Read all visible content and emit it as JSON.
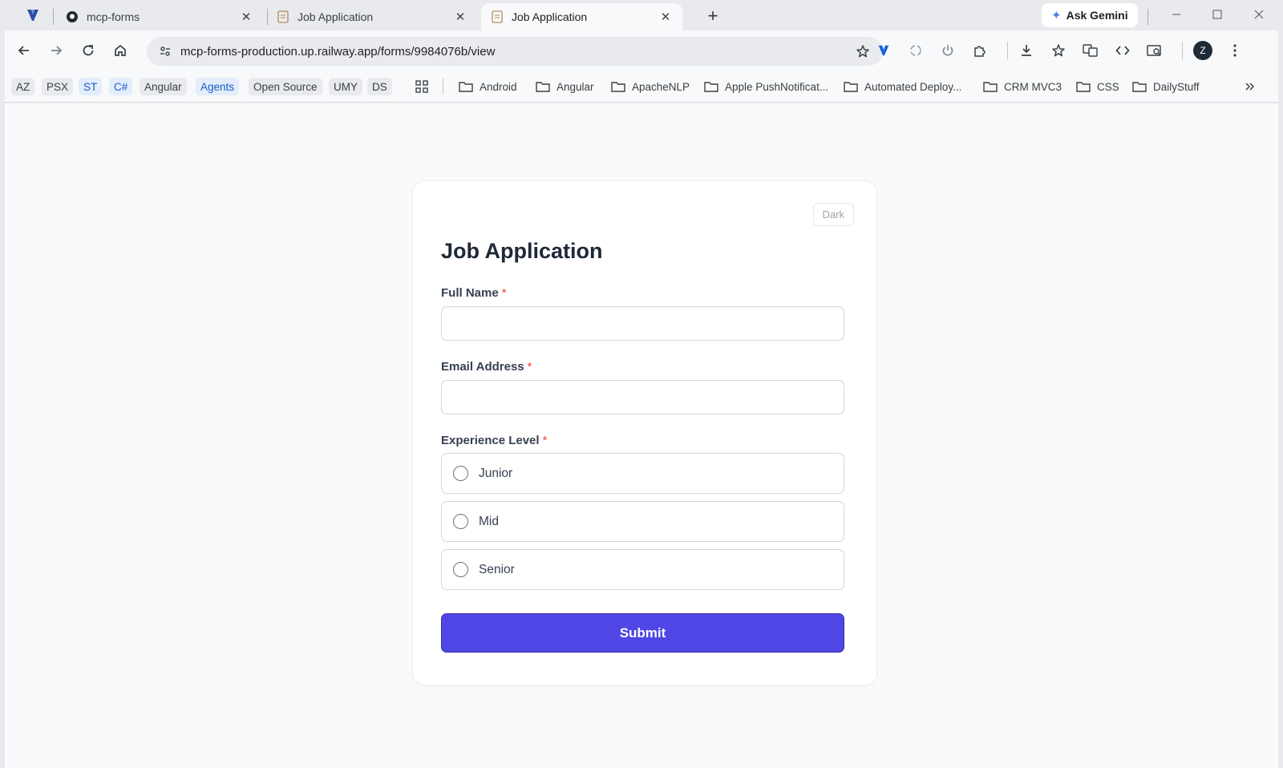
{
  "browser": {
    "tabs": [
      {
        "title": "mcp-forms",
        "active": false
      },
      {
        "title": "Job Application",
        "active": false
      },
      {
        "title": "Job Application",
        "active": true
      }
    ],
    "ask_gemini": "Ask Gemini",
    "url": "mcp-forms-production.up.railway.app/forms/9984076b/view",
    "profile_initial": "Z",
    "bookmarks": {
      "chips": [
        "AZ",
        "PSX",
        "ST",
        "C#",
        "Angular",
        "Agents",
        "Open Source",
        "UMY",
        "DS"
      ],
      "folders": [
        "Android",
        "Angular",
        "ApacheNLP",
        "Apple PushNotificat...",
        "Automated Deploy...",
        "CRM MVC3",
        "CSS",
        "DailyStuff"
      ]
    }
  },
  "form": {
    "theme_toggle": "Dark",
    "title": "Job Application",
    "fields": {
      "full_name": {
        "label": "Full Name",
        "required_mark": "*",
        "value": ""
      },
      "email": {
        "label": "Email Address",
        "required_mark": "*",
        "value": ""
      },
      "experience": {
        "label": "Experience Level",
        "required_mark": "*",
        "options": [
          "Junior",
          "Mid",
          "Senior"
        ],
        "selected": null
      }
    },
    "submit_label": "Submit"
  },
  "colors": {
    "primary": "#4f46e5",
    "required": "#ef4444",
    "page_bg": "#f9fafb"
  }
}
